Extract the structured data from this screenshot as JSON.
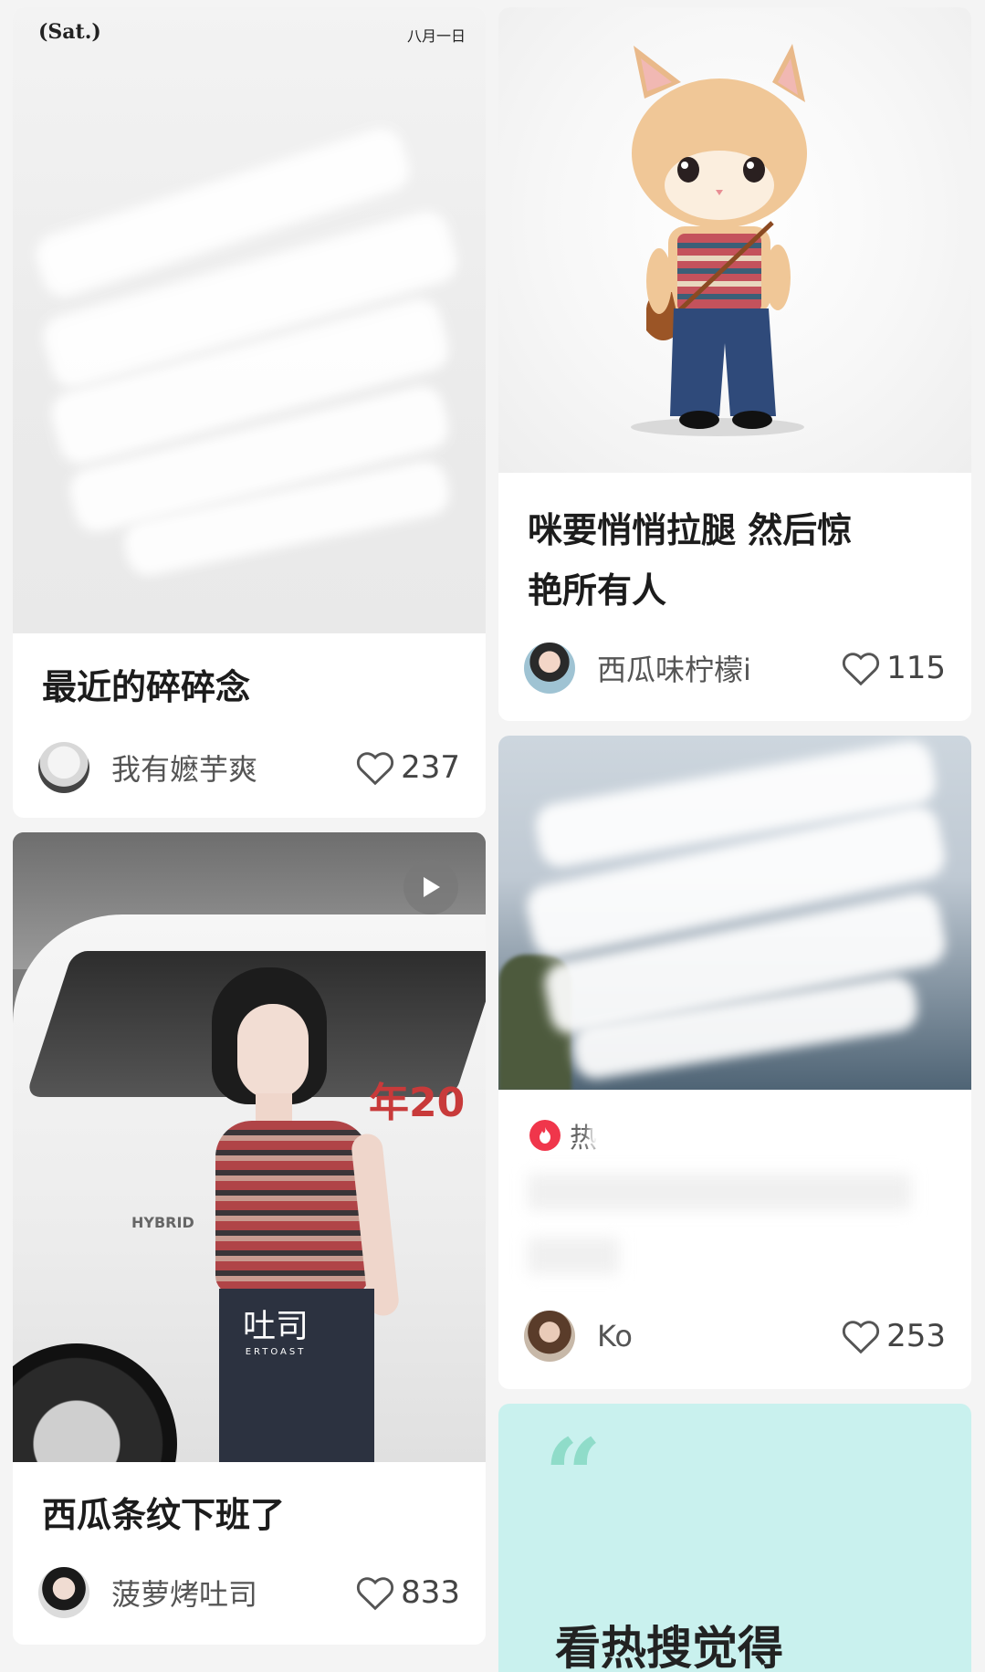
{
  "cards": [
    {
      "cover_header_left": "(Sat.)",
      "cover_header_right": "八月一日",
      "title": "最近的碎碎念",
      "author": "我有嬷芋爽",
      "likes": "237"
    },
    {
      "title_line1": "咪要悄悄拉腿 然后惊",
      "title_line2": "艳所有人",
      "author": "西瓜味柠檬i",
      "likes": "115"
    },
    {
      "watermark": "吐司",
      "watermark_sub": "ERTOAST",
      "car_text": "HYBRID",
      "banner_text": "年20",
      "title": "西瓜条纹下班了",
      "author": "菠萝烤吐司",
      "likes": "833"
    },
    {
      "hot_label": "热",
      "author": "Ko",
      "likes": "253"
    },
    {
      "quote_mark": "“",
      "text": "看热搜觉得"
    }
  ],
  "colors": {
    "hot_red": "#f0364b",
    "quote_bg": "#c9f1ee",
    "quote_mark": "#8fdcc9"
  }
}
